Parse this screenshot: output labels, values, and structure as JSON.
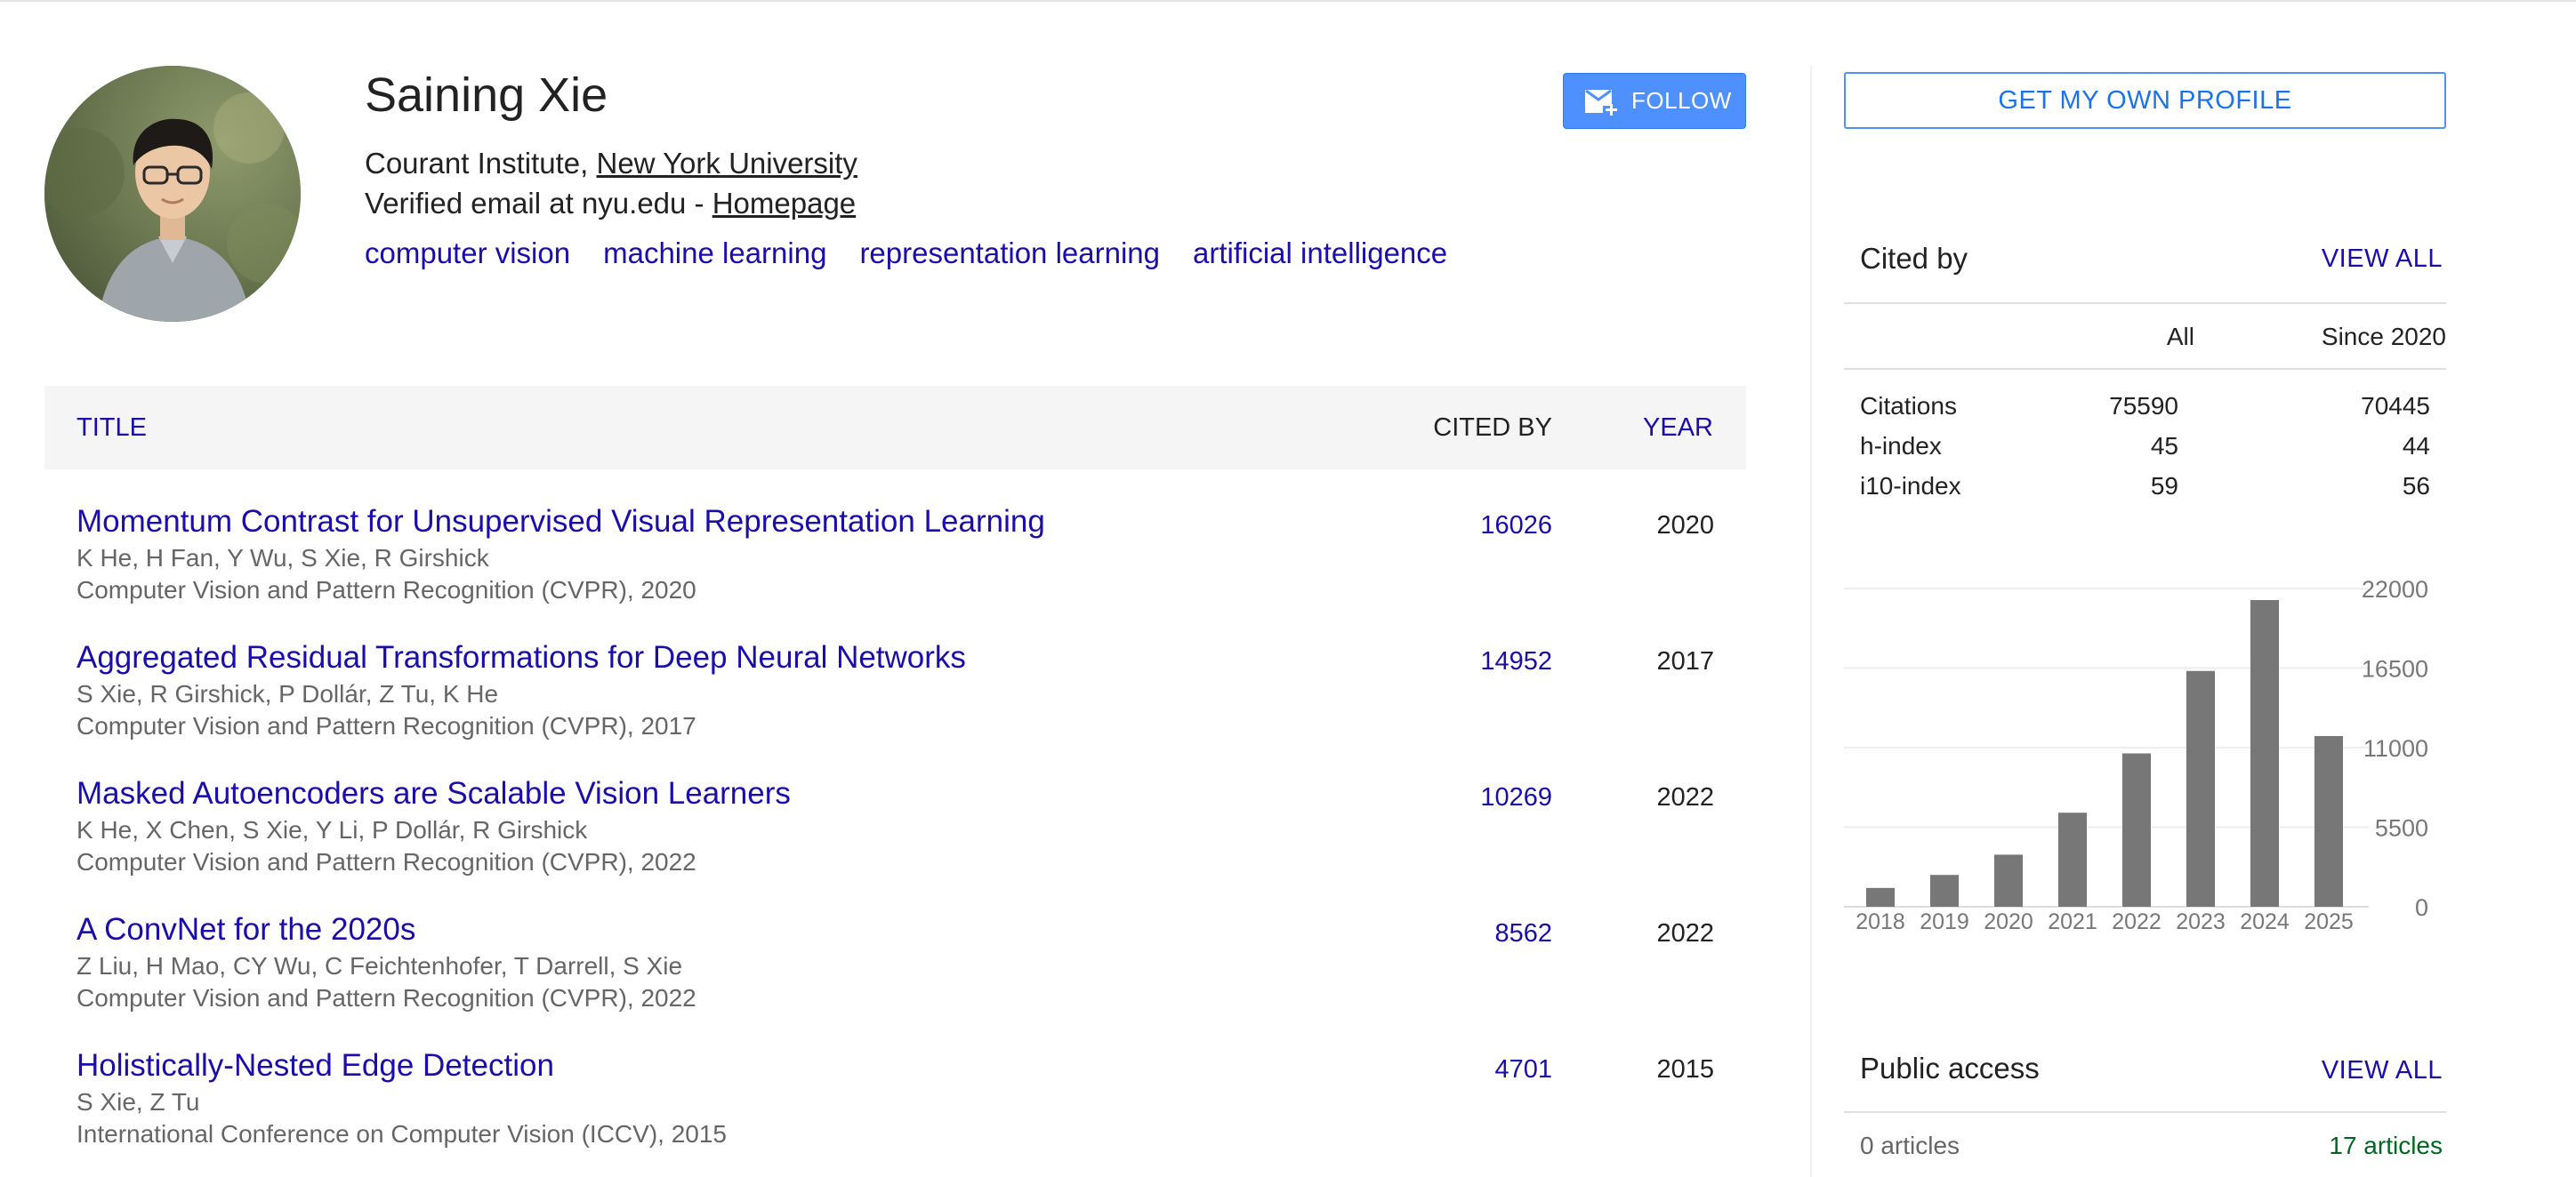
{
  "profile": {
    "name": "Saining Xie",
    "affiliation_prefix": "Courant Institute, ",
    "affiliation_link": "New York University",
    "email_prefix": "Verified email at nyu.edu - ",
    "homepage_link": "Homepage",
    "interests": [
      "computer vision",
      "machine learning",
      "representation learning",
      "artificial intelligence"
    ],
    "follow_label": "FOLLOW"
  },
  "table": {
    "headers": {
      "title": "TITLE",
      "cited_by": "CITED BY",
      "year": "YEAR"
    },
    "publications": [
      {
        "title": "Momentum Contrast for Unsupervised Visual Representation Learning",
        "authors": "K He, H Fan, Y Wu, S Xie, R Girshick",
        "venue": "Computer Vision and Pattern Recognition (CVPR), 2020",
        "cited_by": "16026",
        "year": "2020"
      },
      {
        "title": "Aggregated Residual Transformations for Deep Neural Networks",
        "authors": "S Xie, R Girshick, P Dollár, Z Tu, K He",
        "venue": "Computer Vision and Pattern Recognition (CVPR), 2017",
        "cited_by": "14952",
        "year": "2017"
      },
      {
        "title": "Masked Autoencoders are Scalable Vision Learners",
        "authors": "K He, X Chen, S Xie, Y Li, P Dollár, R Girshick",
        "venue": "Computer Vision and Pattern Recognition (CVPR), 2022",
        "cited_by": "10269",
        "year": "2022"
      },
      {
        "title": "A ConvNet for the 2020s",
        "authors": "Z Liu, H Mao, CY Wu, C Feichtenhofer, T Darrell, S Xie",
        "venue": "Computer Vision and Pattern Recognition (CVPR), 2022",
        "cited_by": "8562",
        "year": "2022"
      },
      {
        "title": "Holistically-Nested Edge Detection",
        "authors": "S Xie, Z Tu",
        "venue": "International Conference on Computer Vision (ICCV), 2015",
        "cited_by": "4701",
        "year": "2015"
      }
    ]
  },
  "sidebar": {
    "get_profile_label": "GET MY OWN PROFILE",
    "cited_by": {
      "title": "Cited by",
      "view_all": "VIEW ALL",
      "col_all": "All",
      "col_since": "Since 2020",
      "rows": [
        {
          "label": "Citations",
          "all": "75590",
          "since": "70445"
        },
        {
          "label": "h-index",
          "all": "45",
          "since": "44"
        },
        {
          "label": "i10-index",
          "all": "59",
          "since": "56"
        }
      ]
    },
    "public_access": {
      "title": "Public access",
      "view_all": "VIEW ALL",
      "not_available": "0 articles",
      "available": "17 articles"
    }
  },
  "colors": {
    "link": "#1a0dab",
    "button": "#4d90fe",
    "bar": "#777777",
    "available": "#006621"
  },
  "chart_data": {
    "type": "bar",
    "categories": [
      "2018",
      "2019",
      "2020",
      "2021",
      "2022",
      "2023",
      "2024",
      "2025"
    ],
    "values": [
      1300,
      2200,
      3600,
      6500,
      10600,
      16300,
      21200,
      11800
    ],
    "yticks": [
      "22000",
      "16500",
      "11000",
      "5500",
      "0"
    ],
    "ylim": [
      0,
      22000
    ],
    "grid": true
  }
}
